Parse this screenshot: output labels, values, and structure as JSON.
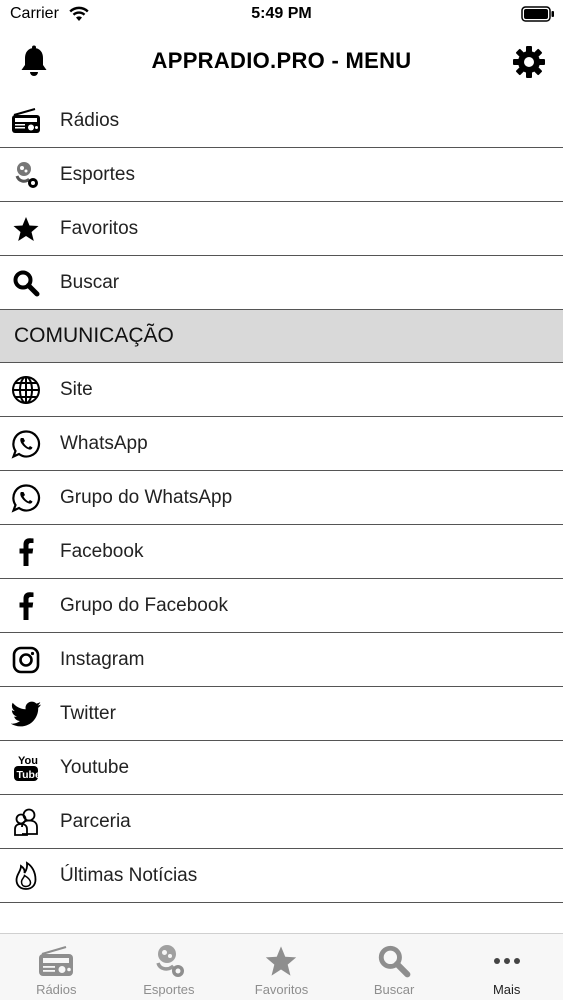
{
  "status_bar": {
    "carrier": "Carrier",
    "time": "5:49 PM"
  },
  "nav": {
    "title": "APPRADIO.PRO - MENU"
  },
  "menu": {
    "items": [
      {
        "label": "Rádios",
        "icon": "radio-icon"
      },
      {
        "label": "Esportes",
        "icon": "sports-icon"
      },
      {
        "label": "Favoritos",
        "icon": "star-icon"
      },
      {
        "label": "Buscar",
        "icon": "search-icon"
      }
    ],
    "section": {
      "label": "COMUNICAÇÃO"
    },
    "communication_items": [
      {
        "label": "Site",
        "icon": "globe-icon"
      },
      {
        "label": "WhatsApp",
        "icon": "whatsapp-icon"
      },
      {
        "label": "Grupo do WhatsApp",
        "icon": "whatsapp-icon"
      },
      {
        "label": "Facebook",
        "icon": "facebook-icon"
      },
      {
        "label": "Grupo do Facebook",
        "icon": "facebook-icon"
      },
      {
        "label": "Instagram",
        "icon": "instagram-icon"
      },
      {
        "label": "Twitter",
        "icon": "twitter-icon"
      },
      {
        "label": "Youtube",
        "icon": "youtube-icon"
      },
      {
        "label": "Parceria",
        "icon": "partners-icon"
      },
      {
        "label": "Últimas Notícias",
        "icon": "flame-icon"
      }
    ]
  },
  "tab_bar": {
    "tabs": [
      {
        "label": "Rádios",
        "icon": "radio-icon",
        "active": false
      },
      {
        "label": "Esportes",
        "icon": "sports-icon",
        "active": false
      },
      {
        "label": "Favoritos",
        "icon": "star-icon",
        "active": false
      },
      {
        "label": "Buscar",
        "icon": "search-icon",
        "active": false
      },
      {
        "label": "Mais",
        "icon": "more-icon",
        "active": true
      }
    ]
  },
  "colors": {
    "section_bg": "#d9d9d9",
    "divider": "#555555",
    "tab_inactive": "#8e8e8e",
    "tab_active": "#222222"
  }
}
